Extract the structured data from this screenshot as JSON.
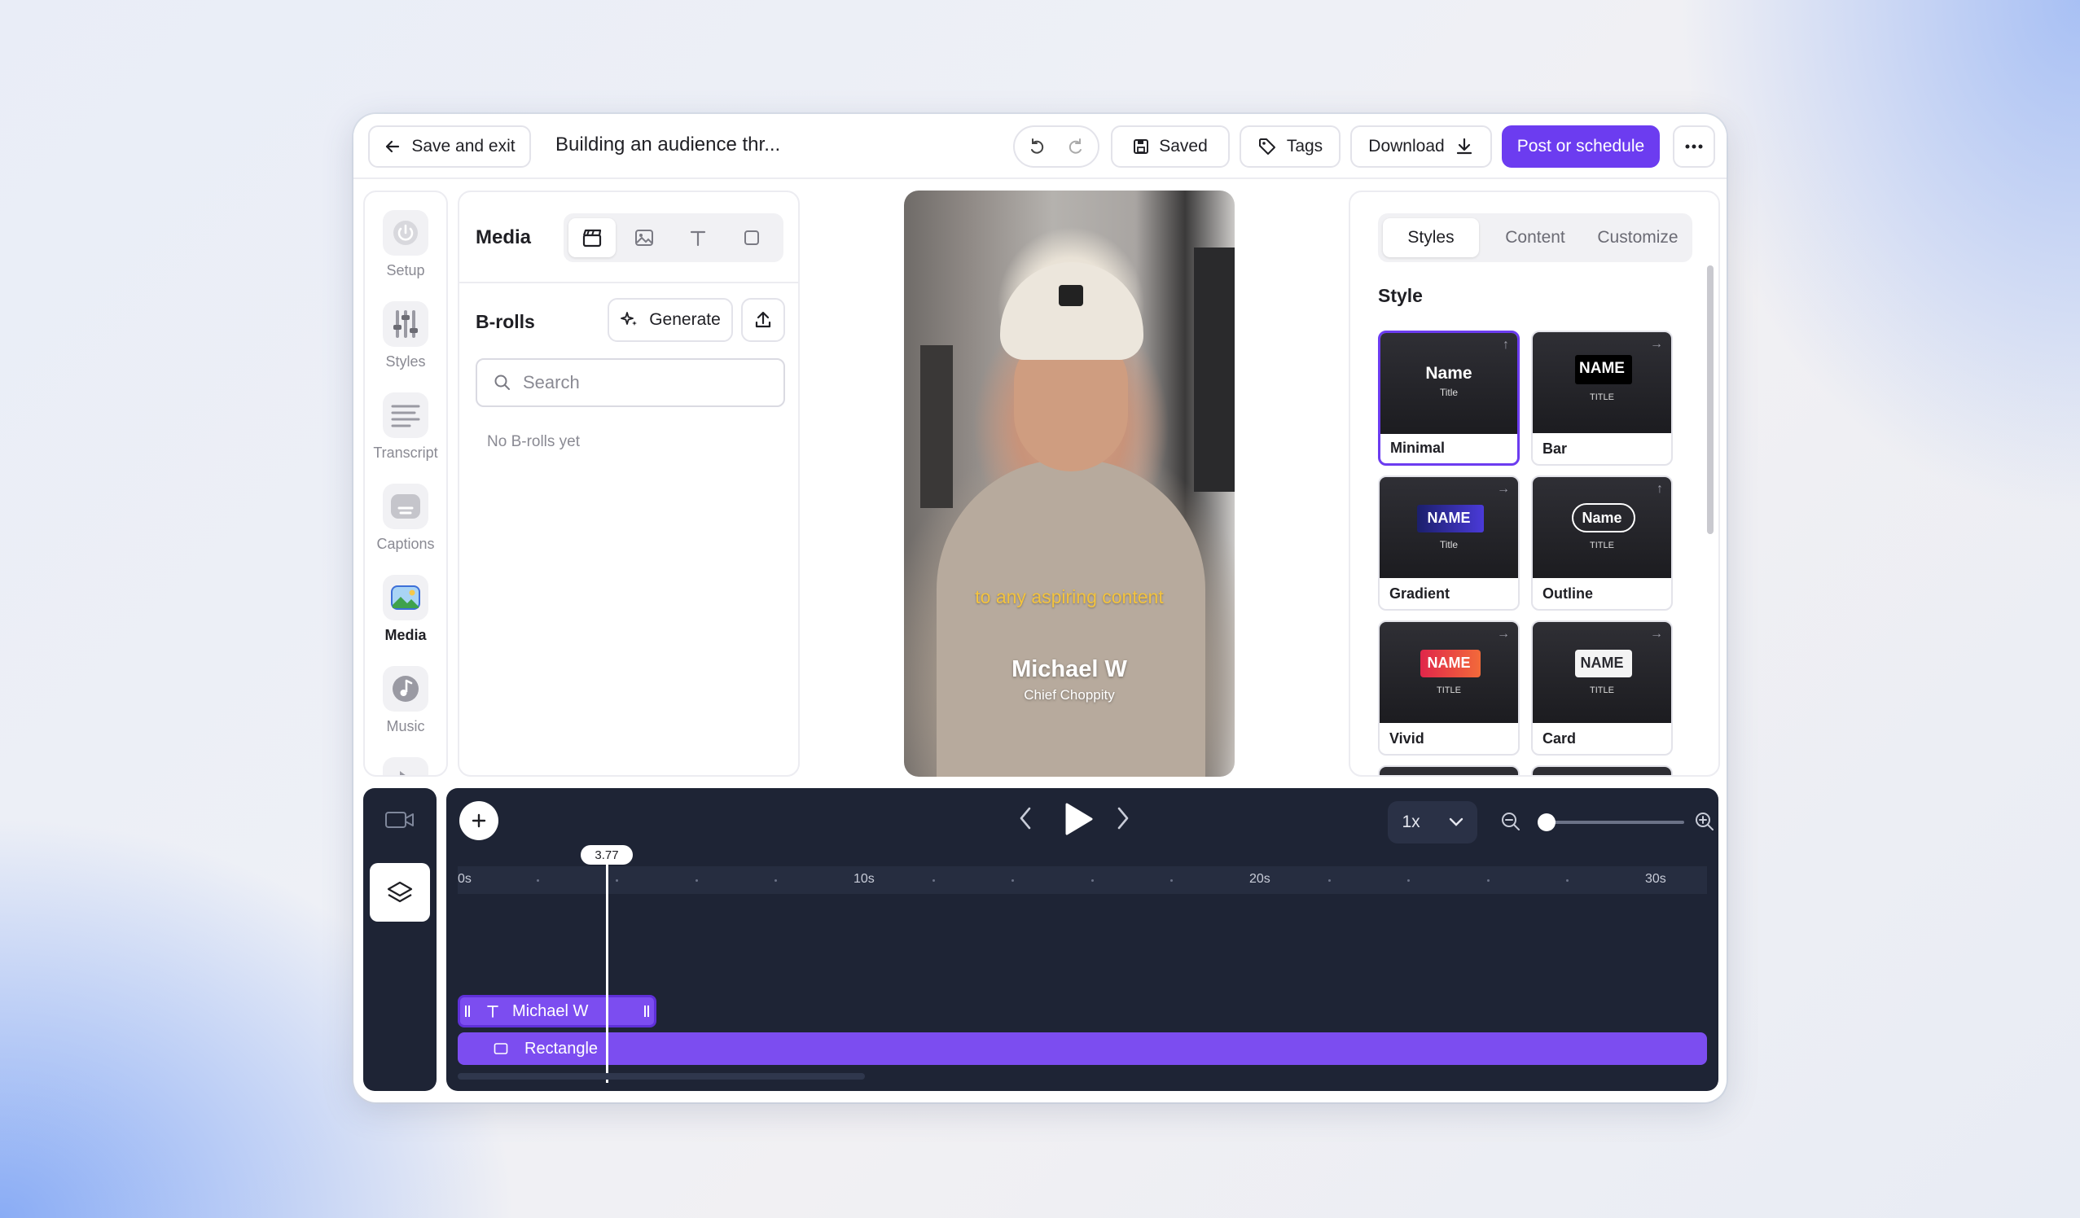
{
  "topbar": {
    "save_exit_label": "Save and exit",
    "project_title": "Building an audience thr...",
    "saved_label": "Saved",
    "tags_label": "Tags",
    "download_label": "Download",
    "post_label": "Post or schedule"
  },
  "rail": {
    "items": [
      {
        "label": "Setup",
        "icon": "power-icon"
      },
      {
        "label": "Styles",
        "icon": "sliders-icon"
      },
      {
        "label": "Transcript",
        "icon": "lines-icon"
      },
      {
        "label": "Captions",
        "icon": "captions-icon"
      },
      {
        "label": "Media",
        "icon": "image-icon",
        "active": true
      },
      {
        "label": "Music",
        "icon": "music-note-icon"
      }
    ]
  },
  "media": {
    "title": "Media",
    "section": "B-rolls",
    "generate_label": "Generate",
    "search_placeholder": "Search",
    "empty_text": "No B-rolls yet"
  },
  "preview": {
    "caption": "to any aspiring content",
    "lower_third_name": "Michael W",
    "lower_third_title": "Chief Choppity"
  },
  "styles_panel": {
    "tabs": [
      "Styles",
      "Content",
      "Customize"
    ],
    "active_tab": "Styles",
    "heading": "Style",
    "cards": [
      {
        "name": "Minimal",
        "thumb_name": "Name",
        "thumb_title": "Title",
        "selected": true
      },
      {
        "name": "Bar",
        "thumb_name": "NAME",
        "thumb_title": "TITLE"
      },
      {
        "name": "Gradient",
        "thumb_name": "NAME",
        "thumb_title": "Title"
      },
      {
        "name": "Outline",
        "thumb_name": "Name",
        "thumb_title": "TITLE"
      },
      {
        "name": "Vivid",
        "thumb_name": "NAME",
        "thumb_title": "TITLE"
      },
      {
        "name": "Card",
        "thumb_name": "NAME",
        "thumb_title": "TITLE"
      }
    ]
  },
  "timeline": {
    "speed": "1x",
    "playhead": "3.77",
    "ruler_labels": [
      "0s",
      "10s",
      "20s",
      "30s"
    ],
    "tracks": [
      {
        "label": "Michael W",
        "type": "text"
      },
      {
        "label": "Rectangle",
        "type": "shape"
      }
    ]
  },
  "colors": {
    "accent": "#6c3cf0",
    "timeline_bg": "#1e2435",
    "caption": "#f3c33e"
  }
}
